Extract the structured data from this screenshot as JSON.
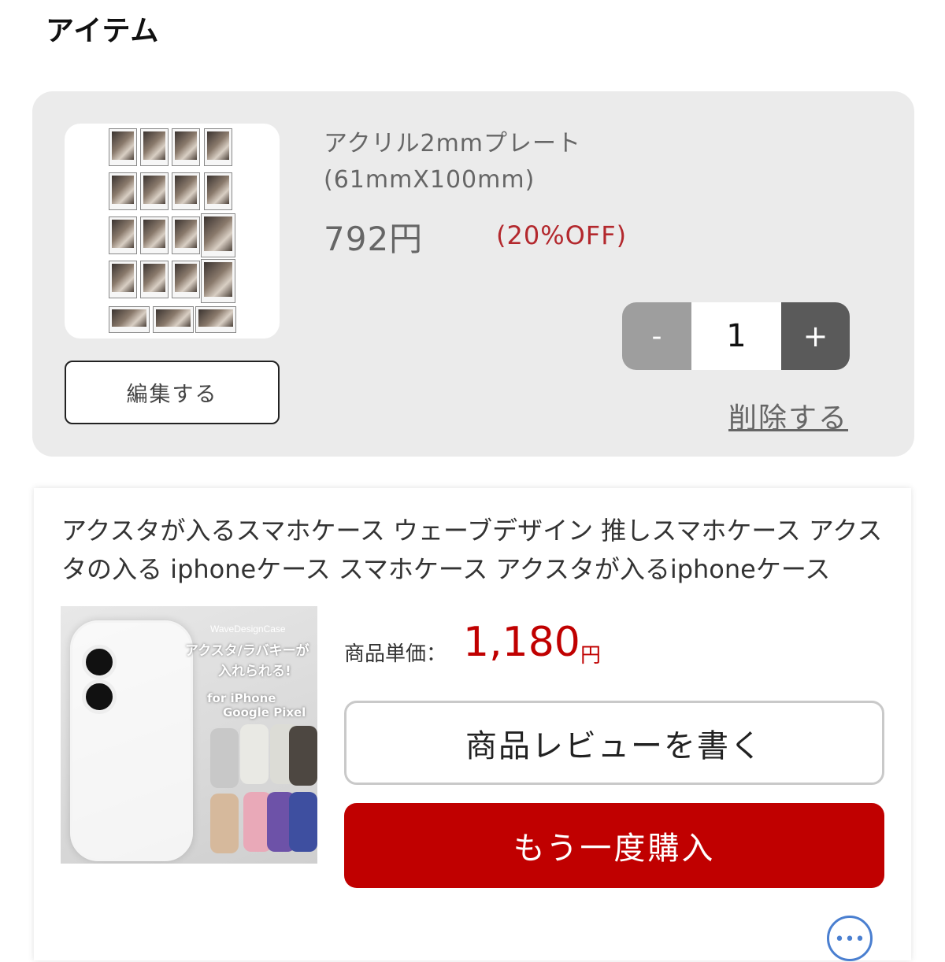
{
  "page": {
    "section_title": "アイテム"
  },
  "cart_item": {
    "name_line1": "アクリル2mmプレート",
    "name_line2": "(61mmX100mm)",
    "price": "792円",
    "discount": "(20%OFF)",
    "edit_label": "編集する",
    "quantity": {
      "minus_label": "-",
      "value": "1",
      "plus_label": "+"
    },
    "delete_label": "削除する"
  },
  "history_item": {
    "title": "アクスタが入るスマホケース ウェーブデザイン 推しスマホケース アクスタの入る iphoneケース スマホケース アクスタが入るiphoneケース",
    "image": {
      "brand": "WaveDesignCase",
      "promo_line1": "アクスタ/ラバキーが",
      "promo_line2": "入れられる!",
      "promo_line3": "for iPhone",
      "promo_line4": "Google Pixel"
    },
    "unit_price_label": "商品単価：",
    "unit_price_value": "1,180",
    "unit_price_currency": "円",
    "review_button_label": "商品レビューを書く",
    "rebuy_button_label": "もう一度購入",
    "more_button_label": "•••"
  },
  "colors": {
    "accent_red": "#c00000",
    "discount_red": "#b3282d",
    "card_gray": "#ebebeb",
    "more_blue": "#4a7fd0"
  }
}
